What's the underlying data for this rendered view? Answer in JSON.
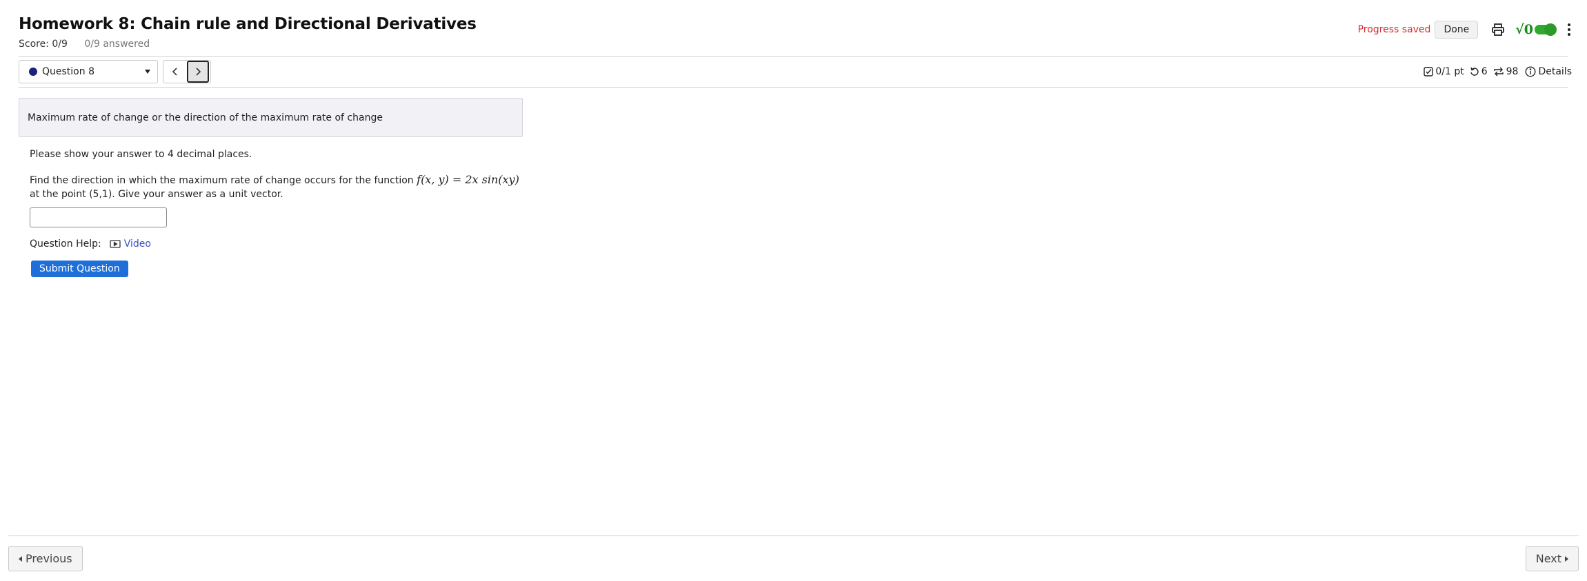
{
  "header": {
    "title": "Homework 8: Chain rule and Directional Derivatives",
    "score": "Score: 0/9",
    "answered": "0/9 answered",
    "progress_saved": "Progress saved",
    "done_label": "Done",
    "math_toggle_glyph": "√0"
  },
  "question_nav": {
    "selected": "Question 8",
    "prev_glyph": "‹",
    "next_glyph": "›"
  },
  "stats": {
    "points": "0/1 pt",
    "retries": "6",
    "attempts": "98",
    "details_label": "Details"
  },
  "question": {
    "banner": "Maximum rate of change or the direction of the maximum rate of change",
    "instruction": "Please show your answer to 4 decimal places.",
    "prompt_before": "Find the direction in which the maximum rate of change occurs for the function ",
    "formula": "f(x, y) = 2x sin(xy)",
    "prompt_after": " at the point (5,1). Give your answer as a unit vector.",
    "answer_value": "",
    "help_label": "Question Help:",
    "video_label": "Video",
    "submit_label": "Submit Question"
  },
  "footer": {
    "previous_label": "Previous",
    "next_label": "Next"
  },
  "colors": {
    "accent": "#1e6fd9",
    "progress_saved": "#d32f2f",
    "toggle_green": "#2eaa2e",
    "question_dot": "#1a237e",
    "link": "#3a4fc4"
  },
  "icons": [
    "print-icon",
    "math-toggle-icon",
    "kebab-menu-icon",
    "checkbox-icon",
    "retry-icon",
    "attempts-icon",
    "info-icon",
    "video-icon"
  ]
}
